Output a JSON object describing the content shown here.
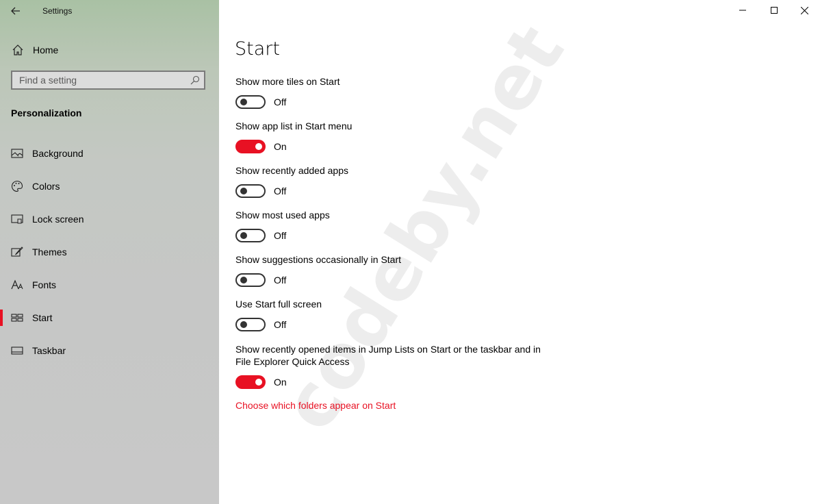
{
  "window": {
    "title": "Settings"
  },
  "sidebar": {
    "home_label": "Home",
    "search_placeholder": "Find a setting",
    "section": "Personalization",
    "items": [
      {
        "label": "Background",
        "icon": "picture-icon"
      },
      {
        "label": "Colors",
        "icon": "palette-icon"
      },
      {
        "label": "Lock screen",
        "icon": "lock-screen-icon"
      },
      {
        "label": "Themes",
        "icon": "brush-icon"
      },
      {
        "label": "Fonts",
        "icon": "font-icon"
      },
      {
        "label": "Start",
        "icon": "start-tiles-icon",
        "selected": true
      },
      {
        "label": "Taskbar",
        "icon": "taskbar-icon"
      }
    ]
  },
  "main": {
    "title": "Start",
    "settings": [
      {
        "label": "Show more tiles on Start",
        "state": "Off",
        "on": false
      },
      {
        "label": "Show app list in Start menu",
        "state": "On",
        "on": true
      },
      {
        "label": "Show recently added apps",
        "state": "Off",
        "on": false
      },
      {
        "label": "Show most used apps",
        "state": "Off",
        "on": false
      },
      {
        "label": "Show suggestions occasionally in Start",
        "state": "Off",
        "on": false
      },
      {
        "label": "Use Start full screen",
        "state": "Off",
        "on": false
      },
      {
        "label": "Show recently opened items in Jump Lists on Start or the taskbar and in File Explorer Quick Access",
        "state": "On",
        "on": true
      }
    ],
    "link": "Choose which folders appear on Start"
  },
  "watermark": "codeby.net",
  "colors": {
    "accent": "#e81123"
  }
}
